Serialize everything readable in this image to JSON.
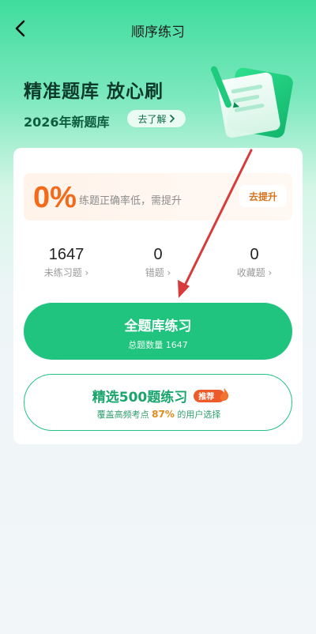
{
  "header": {
    "title": "顺序练习",
    "back_icon": "chevron-left-icon"
  },
  "hero": {
    "title": "精准题库 放心刷",
    "subtitle": "2026年新题库",
    "learn_label": "去了解"
  },
  "accuracy": {
    "percent": "0%",
    "message": "练题正确率低，需提升",
    "improve_label": "去提升"
  },
  "stats": [
    {
      "value": "1647",
      "label": "未练习题 ›"
    },
    {
      "value": "0",
      "label": "错题 ›"
    },
    {
      "value": "0",
      "label": "收藏题 ›"
    }
  ],
  "primary": {
    "title": "全题库练习",
    "subtitle": "总题数量 1647"
  },
  "secondary": {
    "title": "精选500题练习",
    "badge": "推荐",
    "subtitle_prefix": "覆盖高频考点",
    "subtitle_highlight": "87%",
    "subtitle_suffix": "的用户选择"
  },
  "colors": {
    "accent_green": "#20c47f",
    "warning_orange": "#f36a1a",
    "annotation_red": "#d63c3c"
  }
}
